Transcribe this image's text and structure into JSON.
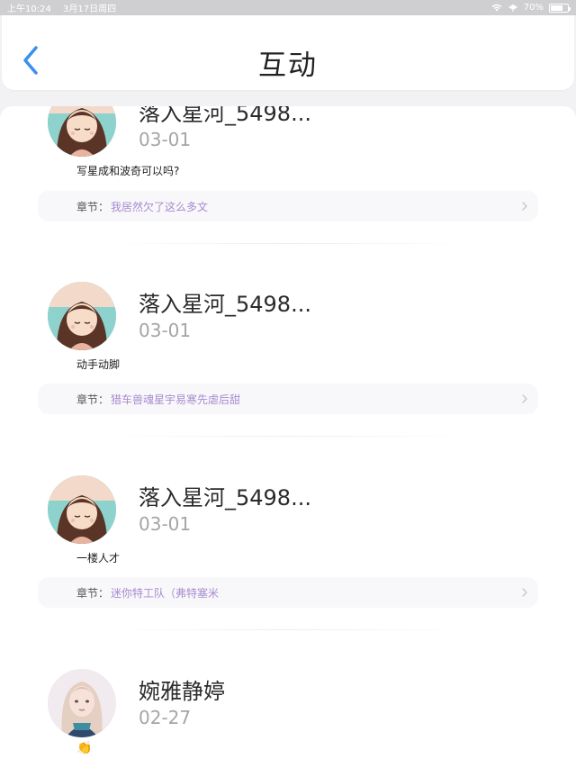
{
  "status_bar": {
    "time": "上午10:24",
    "date": "3月17日周四",
    "battery": "70%",
    "battery_level": 0.7
  },
  "header": {
    "title": "互动"
  },
  "chapter_label": "章节：",
  "comments": [
    {
      "username": "落入星河_5498...",
      "date": "03-01",
      "text": "写星成和波奇可以吗?",
      "chapter": "我居然欠了这么多文"
    },
    {
      "username": "落入星河_5498...",
      "date": "03-01",
      "text": "动手动脚",
      "chapter": "猎车兽魂星宇易寒先虐后甜"
    },
    {
      "username": "落入星河_5498...",
      "date": "03-01",
      "text": "一楼人才",
      "chapter": "迷你特工队（弗特塞米"
    },
    {
      "username": "婉雅静婷",
      "date": "02-27",
      "text": "👏"
    }
  ],
  "colors": {
    "accent": "#3b8ff0",
    "chapter_text": "#a78bd0",
    "background": "#f2f2f4"
  },
  "icons": {
    "back": "chevron-left-icon",
    "chapter": "chevron-right-icon",
    "wifi": "wifi-icon",
    "battery": "battery-icon"
  }
}
